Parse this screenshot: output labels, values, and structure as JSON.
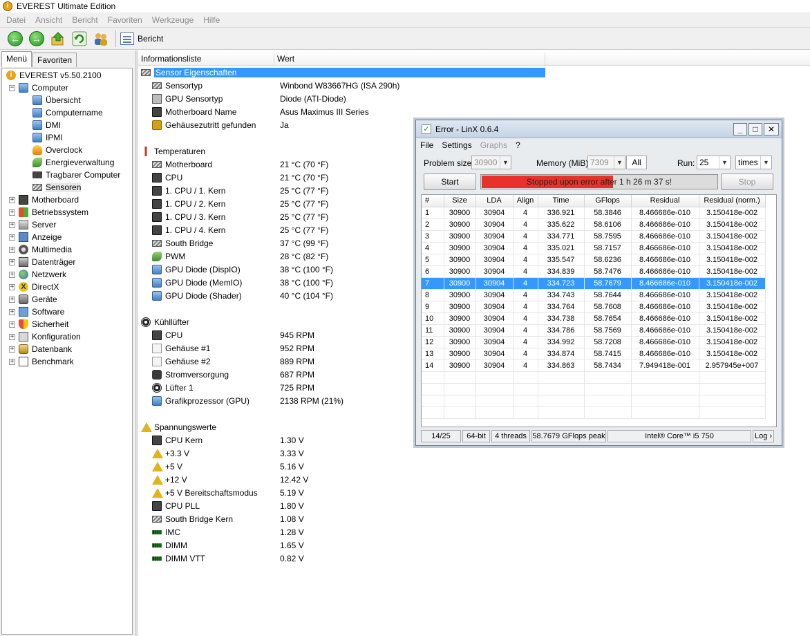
{
  "window": {
    "title": "EVEREST Ultimate Edition"
  },
  "menubar": [
    "Datei",
    "Ansicht",
    "Bericht",
    "Favoriten",
    "Werkzeuge",
    "Hilfe"
  ],
  "toolbar": {
    "report_label": "Bericht"
  },
  "left_tabs": [
    "Menü",
    "Favoriten"
  ],
  "tree": {
    "root": "EVEREST v5.50.2100",
    "computer": "Computer",
    "computer_children": [
      "Übersicht",
      "Computername",
      "DMI",
      "IPMI",
      "Overclock",
      "Energieverwaltung",
      "Tragbarer Computer",
      "Sensoren"
    ],
    "categories": [
      "Motherboard",
      "Betriebssystem",
      "Server",
      "Anzeige",
      "Multimedia",
      "Datenträger",
      "Netzwerk",
      "DirectX",
      "Geräte",
      "Software",
      "Sicherheit",
      "Konfiguration",
      "Datenbank",
      "Benchmark"
    ]
  },
  "list": {
    "col1": "Informationsliste",
    "col2": "Wert",
    "sensor_header": "Sensor Eigenschaften",
    "sensor_props": [
      {
        "name": "Sensortyp",
        "value": "Winbond W83667HG  (ISA 290h)"
      },
      {
        "name": "GPU Sensortyp",
        "value": "Diode  (ATI-Diode)"
      },
      {
        "name": "Motherboard Name",
        "value": "Asus Maximus III Series"
      },
      {
        "name": "Gehäusezutritt gefunden",
        "value": "Ja"
      }
    ],
    "temp_header": "Temperaturen",
    "temps": [
      {
        "name": "Motherboard",
        "value": "21 °C  (70 °F)"
      },
      {
        "name": "CPU",
        "value": "21 °C  (70 °F)"
      },
      {
        "name": "1. CPU / 1. Kern",
        "value": "25 °C  (77 °F)"
      },
      {
        "name": "1. CPU / 2. Kern",
        "value": "25 °C  (77 °F)"
      },
      {
        "name": "1. CPU / 3. Kern",
        "value": "25 °C  (77 °F)"
      },
      {
        "name": "1. CPU / 4. Kern",
        "value": "25 °C  (77 °F)"
      },
      {
        "name": "South Bridge",
        "value": "37 °C  (99 °F)"
      },
      {
        "name": "PWM",
        "value": "28 °C  (82 °F)"
      },
      {
        "name": "GPU Diode (DispIO)",
        "value": "38 °C  (100 °F)"
      },
      {
        "name": "GPU Diode (MemIO)",
        "value": "38 °C  (100 °F)"
      },
      {
        "name": "GPU Diode (Shader)",
        "value": "40 °C  (104 °F)"
      }
    ],
    "fan_header": "Kühllüfter",
    "fans": [
      {
        "name": "CPU",
        "value": "945 RPM"
      },
      {
        "name": "Gehäuse #1",
        "value": "952 RPM"
      },
      {
        "name": "Gehäuse #2",
        "value": "889 RPM"
      },
      {
        "name": "Stromversorgung",
        "value": "687 RPM"
      },
      {
        "name": "Lüfter 1",
        "value": "725 RPM"
      },
      {
        "name": "Grafikprozessor (GPU)",
        "value": "2138 RPM  (21%)"
      }
    ],
    "volt_header": "Spannungswerte",
    "volts": [
      {
        "name": "CPU Kern",
        "value": "1.30 V"
      },
      {
        "name": "+3.3 V",
        "value": "3.33 V"
      },
      {
        "name": "+5 V",
        "value": "5.16 V"
      },
      {
        "name": "+12 V",
        "value": "12.42 V"
      },
      {
        "name": "+5 V Bereitschaftsmodus",
        "value": "5.19 V"
      },
      {
        "name": "CPU PLL",
        "value": "1.80 V"
      },
      {
        "name": "South Bridge Kern",
        "value": "1.08 V"
      },
      {
        "name": "IMC",
        "value": "1.28 V"
      },
      {
        "name": "DIMM",
        "value": "1.65 V"
      },
      {
        "name": "DIMM VTT",
        "value": "0.82 V"
      }
    ]
  },
  "linx": {
    "title": "Error - LinX 0.6.4",
    "menu": [
      "File",
      "Settings",
      "Graphs",
      "?"
    ],
    "problem_size_label": "Problem size:",
    "problem_size_value": "30900",
    "memory_label": "Memory (MiB):",
    "memory_value": "7309",
    "all_label": "All",
    "run_label": "Run:",
    "run_value": "25",
    "run_unit": "times",
    "start_label": "Start",
    "stop_label": "Stop",
    "progress_text": "Stopped upon error after 1 h 26 m 37 s!",
    "progress_fraction": 0.56,
    "columns": [
      "#",
      "Size",
      "LDA",
      "Align",
      "Time",
      "GFlops",
      "Residual",
      "Residual (norm.)"
    ],
    "rows": [
      [
        "1",
        "30900",
        "30904",
        "4",
        "336.921",
        "58.3846",
        "8.466686e-010",
        "3.150418e-002"
      ],
      [
        "2",
        "30900",
        "30904",
        "4",
        "335.622",
        "58.6106",
        "8.466686e-010",
        "3.150418e-002"
      ],
      [
        "3",
        "30900",
        "30904",
        "4",
        "334.771",
        "58.7595",
        "8.466686e-010",
        "3.150418e-002"
      ],
      [
        "4",
        "30900",
        "30904",
        "4",
        "335.021",
        "58.7157",
        "8.466686e-010",
        "3.150418e-002"
      ],
      [
        "5",
        "30900",
        "30904",
        "4",
        "335.547",
        "58.6236",
        "8.466686e-010",
        "3.150418e-002"
      ],
      [
        "6",
        "30900",
        "30904",
        "4",
        "334.839",
        "58.7476",
        "8.466686e-010",
        "3.150418e-002"
      ],
      [
        "7",
        "30900",
        "30904",
        "4",
        "334.723",
        "58.7679",
        "8.466686e-010",
        "3.150418e-002"
      ],
      [
        "8",
        "30900",
        "30904",
        "4",
        "334.743",
        "58.7644",
        "8.466686e-010",
        "3.150418e-002"
      ],
      [
        "9",
        "30900",
        "30904",
        "4",
        "334.764",
        "58.7608",
        "8.466686e-010",
        "3.150418e-002"
      ],
      [
        "10",
        "30900",
        "30904",
        "4",
        "334.738",
        "58.7654",
        "8.466686e-010",
        "3.150418e-002"
      ],
      [
        "11",
        "30900",
        "30904",
        "4",
        "334.786",
        "58.7569",
        "8.466686e-010",
        "3.150418e-002"
      ],
      [
        "12",
        "30900",
        "30904",
        "4",
        "334.992",
        "58.7208",
        "8.466686e-010",
        "3.150418e-002"
      ],
      [
        "13",
        "30900",
        "30904",
        "4",
        "334.874",
        "58.7415",
        "8.466686e-010",
        "3.150418e-002"
      ],
      [
        "14",
        "30900",
        "30904",
        "4",
        "334.863",
        "58.7434",
        "7.949418e-001",
        "2.957945e+007"
      ]
    ],
    "selected_row": 6,
    "status": [
      "14/25",
      "64-bit",
      "4 threads",
      "58.7679 GFlops peak",
      "Intel® Core™ i5 750",
      "Log ›"
    ]
  },
  "colors": {
    "selection": "#3399ff",
    "error_bar": "#e8312b"
  }
}
